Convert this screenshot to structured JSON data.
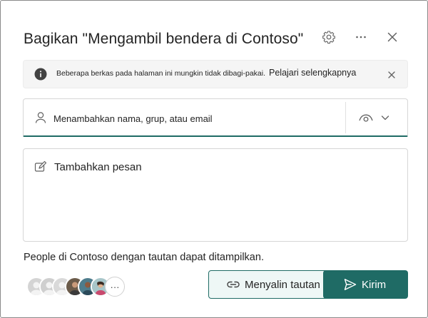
{
  "dialog": {
    "title": "Bagikan \"Mengambil bendera di Contoso\"",
    "icons": {
      "settings": "gear-icon",
      "more": "more-horizontal-icon",
      "close": "close-icon"
    }
  },
  "banner": {
    "message": "Beberapa berkas pada halaman ini mungkin tidak dibagi-pakai.",
    "link": "Pelajari selengkapnya"
  },
  "people_picker": {
    "placeholder": "Menambahkan nama, grup, atau email"
  },
  "message_box": {
    "placeholder": "Tambahkan pesan"
  },
  "scope_text": "People di Contoso dengan tautan dapat ditampilkan.",
  "avatars": {
    "more_label": "···"
  },
  "actions": {
    "copy_link": "Menyalin tautan",
    "send": "Kirim"
  },
  "colors": {
    "accent": "#1f6b65",
    "accent_light": "#eef7f6",
    "banner_bg": "#f5f5f5",
    "text": "#242424"
  }
}
